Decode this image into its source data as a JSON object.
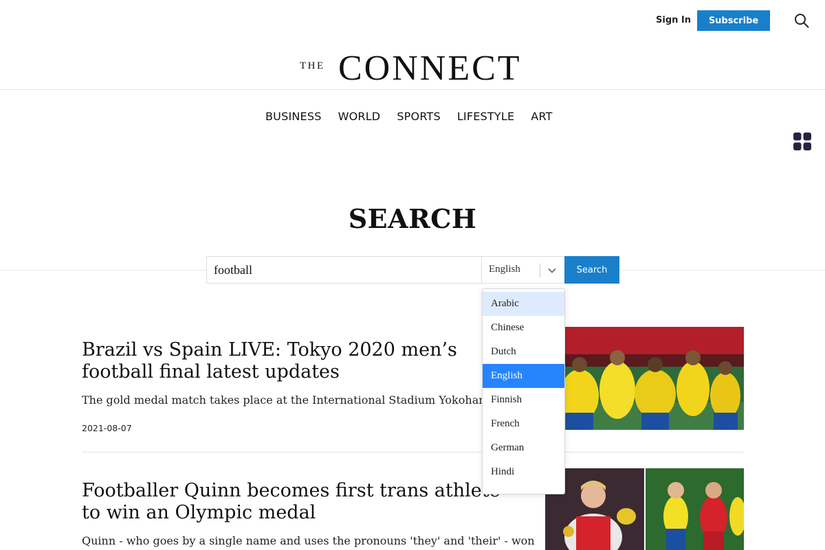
{
  "header": {
    "signin_label": "Sign In",
    "subscribe_label": "Subscribe",
    "search_icon": "search-icon",
    "logo_the": "THE",
    "logo_name": "CONNECT"
  },
  "nav": {
    "items": [
      "BUSINESS",
      "WORLD",
      "SPORTS",
      "LIFESTYLE",
      "ART"
    ],
    "grid_icon": "grid-icon"
  },
  "search": {
    "title": "SEARCH",
    "query": "football",
    "language": "English",
    "button_label": "Search",
    "options": [
      "Arabic",
      "Chinese",
      "Dutch",
      "English",
      "Finnish",
      "French",
      "German",
      "Hindi"
    ],
    "highlighted_option": "Arabic",
    "selected_option": "English"
  },
  "articles": [
    {
      "title": "Brazil vs Spain LIVE: Tokyo 2020 men’s football final latest updates",
      "description": "The gold medal match takes place at the International Stadium Yokohama",
      "date": "2021-08-07"
    },
    {
      "title": "Footballer Quinn becomes first trans athlete to win an Olympic medal",
      "description": "Quinn - who goes by a single name and uses the pronouns 'they' and 'their' - won"
    }
  ],
  "colors": {
    "accent": "#1a7fcb",
    "option_selected": "#2684ff",
    "option_hover": "#deebff"
  }
}
